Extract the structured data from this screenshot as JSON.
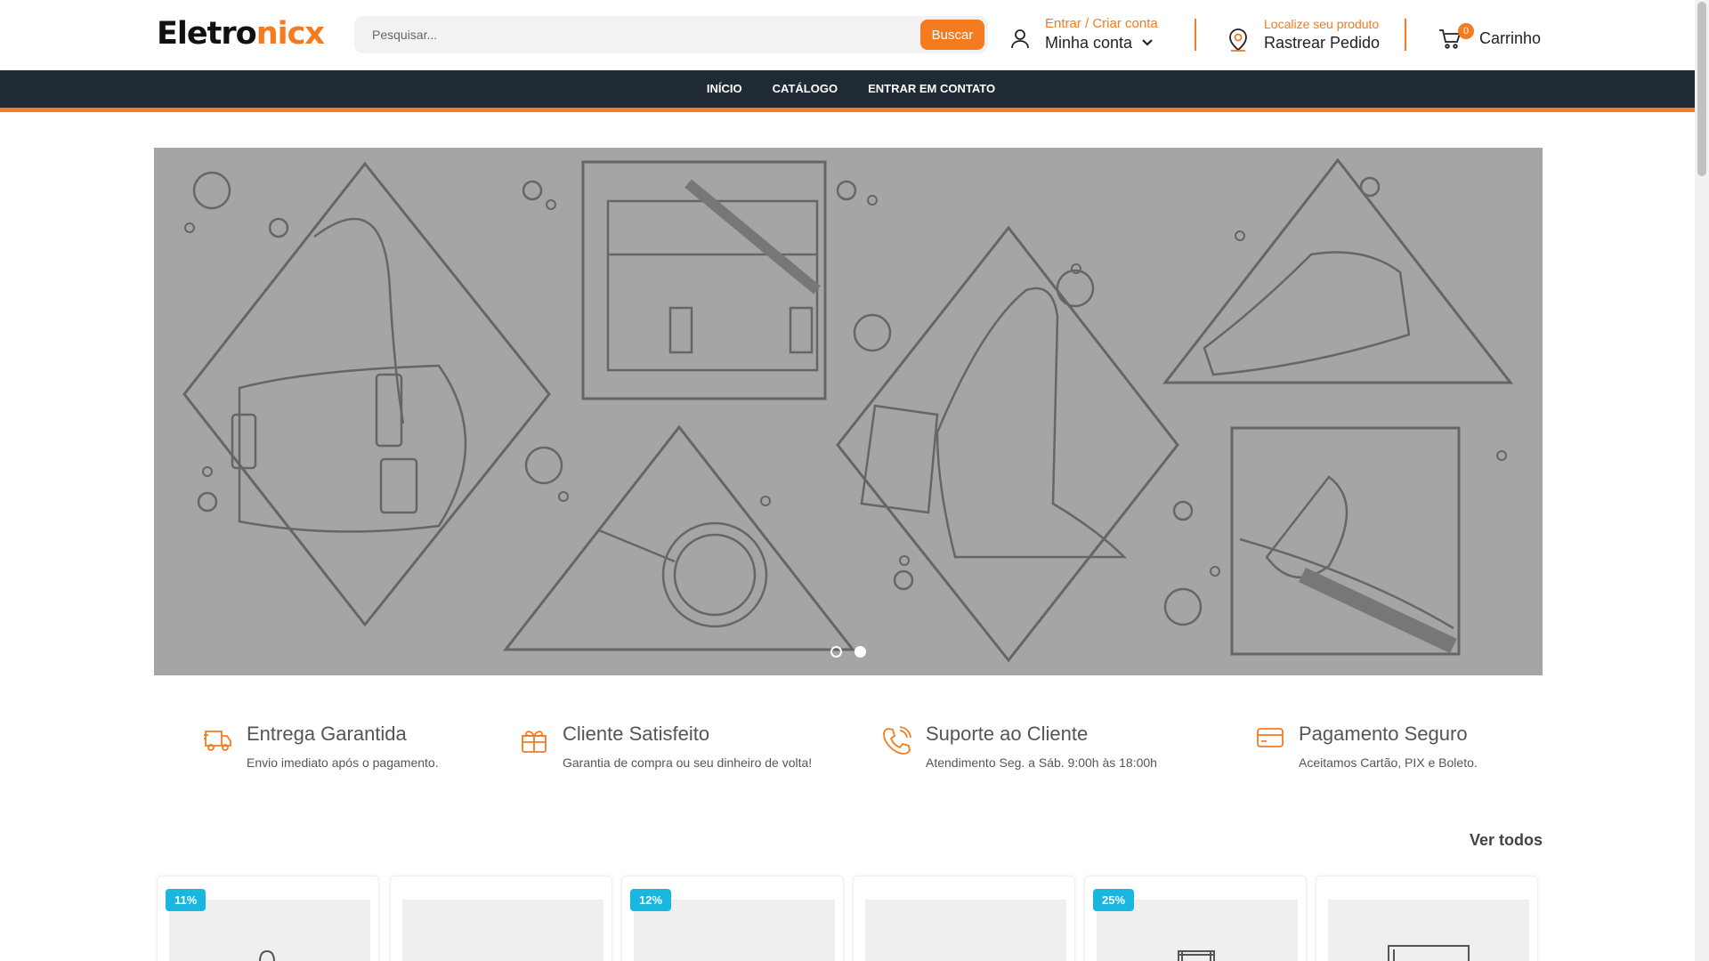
{
  "header": {
    "logo_part1": "Eletro",
    "logo_part2": "nicx",
    "search_placeholder": "Pesquisar...",
    "search_button": "Buscar",
    "account_small": "Entrar / Criar conta",
    "account_big": "Minha conta",
    "track_small": "Localize seu produto",
    "track_big": "Rastrear Pedido",
    "cart_count": "0",
    "cart_label": "Carrinho"
  },
  "nav": {
    "items": [
      "INÍCIO",
      "CATÁLOGO",
      "ENTRAR EM CONTATO"
    ]
  },
  "banner": {
    "slide_count": 2,
    "active_slide": 2
  },
  "features": [
    {
      "title": "Entrega Garantida",
      "desc": "Envio imediato após o pagamento.",
      "icon": "truck-icon"
    },
    {
      "title": "Cliente Satisfeito",
      "desc": "Garantia de compra ou seu dinheiro de volta!",
      "icon": "gift-box-icon"
    },
    {
      "title": "Suporte ao Cliente",
      "desc": "Atendimento Seg. a Sáb. 9:00h às 18:00h",
      "icon": "phone-icon"
    },
    {
      "title": "Pagamento Seguro",
      "desc": "Aceitamos Cartão, PIX e Boleto.",
      "icon": "credit-card-icon"
    }
  ],
  "products": {
    "see_all": "Ver todos",
    "discounts": [
      "11%",
      "",
      "12%",
      "",
      "25%",
      ""
    ]
  },
  "colors": {
    "accent": "#f47b20",
    "nav_bg": "#1f2a35",
    "discount_badge": "#19b6e0",
    "banner_bg": "#a5a5a5"
  }
}
